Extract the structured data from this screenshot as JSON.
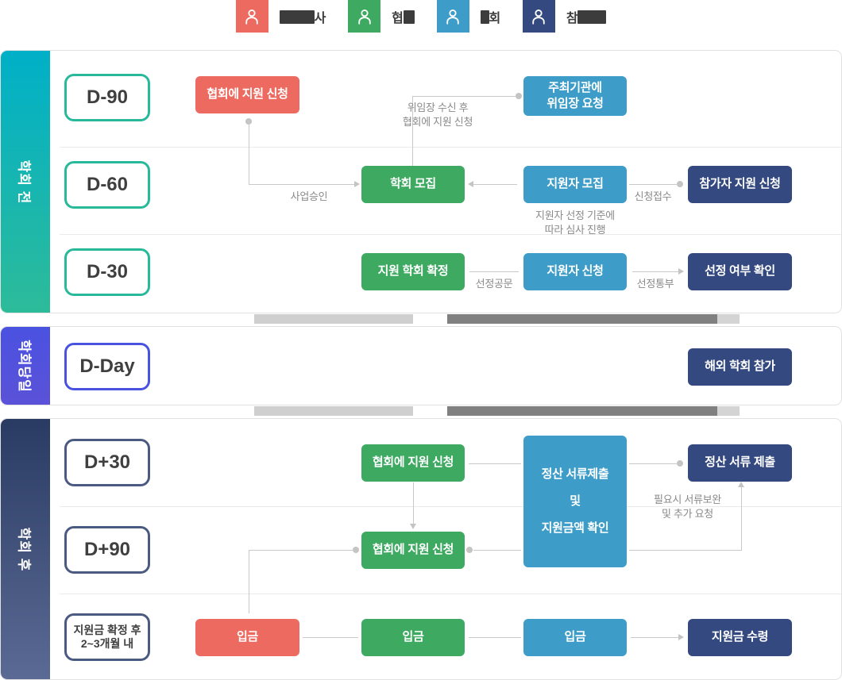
{
  "legend": {
    "items": [
      {
        "label": "주최사",
        "label_visible": "주최사",
        "obscured": true,
        "color": "#ec6a60",
        "icon": "person-icon"
      },
      {
        "label": "협회",
        "label_visible": "협회",
        "obscured": true,
        "color": "#3da961",
        "icon": "person-icon"
      },
      {
        "label": "학회",
        "label_visible": "학회",
        "obscured": true,
        "color": "#3d9dc8",
        "icon": "person-icon"
      },
      {
        "label": "참가자",
        "label_visible": "참가자",
        "obscured": true,
        "color": "#33497f",
        "icon": "person-icon"
      }
    ]
  },
  "sections": [
    {
      "id": "pre",
      "tab_label": "학회 전",
      "tab_color": "#17b5b8"
    },
    {
      "id": "day",
      "tab_label": "학회당일",
      "tab_color": "#4a52e0"
    },
    {
      "id": "post",
      "tab_label": "학회 후",
      "tab_color": "#3b4c76"
    }
  ],
  "pre": {
    "rows": [
      {
        "chip": "D-90",
        "nodes": [
          {
            "label": "협회에 지원 신청",
            "color": "red"
          },
          {
            "label": "주최기관에\n위임장 요청",
            "color": "blue",
            "line1": "주최기관에",
            "line2": "위임장 요청"
          }
        ],
        "edge_labels": [
          {
            "line1": "위임장 수신 후",
            "line2": "협회에 지원 신청"
          }
        ]
      },
      {
        "chip": "D-60",
        "nodes": [
          {
            "label": "학회 모집",
            "color": "green"
          },
          {
            "label": "지원자 모집",
            "color": "blue"
          },
          {
            "label": "참가자 지원 신청",
            "color": "navy"
          }
        ],
        "edge_labels": [
          {
            "line1": "사업승인"
          },
          {
            "line1": "신청접수"
          },
          {
            "line1": "지원자 선정 기준에",
            "line2": "따라 심사 진행"
          }
        ]
      },
      {
        "chip": "D-30",
        "nodes": [
          {
            "label": "지원 학회 확정",
            "color": "green"
          },
          {
            "label": "지원자 신청",
            "color": "blue"
          },
          {
            "label": "선정 여부 확인",
            "color": "navy"
          }
        ],
        "edge_labels": [
          {
            "line1": "선정공문"
          },
          {
            "line1": "선정통부"
          }
        ]
      }
    ]
  },
  "day": {
    "rows": [
      {
        "chip": "D-Day",
        "nodes": [
          {
            "label": "해외 학회 참가",
            "color": "navy"
          }
        ]
      }
    ]
  },
  "post": {
    "rows": [
      {
        "chip": "D+30",
        "nodes": [
          {
            "label": "협회에 지원 신청",
            "color": "green"
          },
          {
            "label": "정산 서류제출\n및\n지원금액 확인",
            "color": "blue",
            "line1": "정산 서류제출",
            "line2": "및",
            "line3": "지원금액 확인"
          },
          {
            "label": "정산 서류 제출",
            "color": "navy"
          }
        ]
      },
      {
        "chip": "D+90",
        "nodes": [
          {
            "label": "협회에 지원 신청",
            "color": "green"
          }
        ],
        "edge_labels": [
          {
            "line1": "필요시 서류보완",
            "line2": "및 추가 요청"
          }
        ]
      },
      {
        "chip": "지원금 확정 후\n2~3개월 내",
        "chip_line1": "지원금 확정 후",
        "chip_line2": "2~3개월 내",
        "nodes": [
          {
            "label": "입금",
            "color": "red"
          },
          {
            "label": "입금",
            "color": "green"
          },
          {
            "label": "입금",
            "color": "blue"
          },
          {
            "label": "지원금 수령",
            "color": "navy"
          }
        ]
      }
    ]
  },
  "colors": {
    "red": "#ec6a60",
    "green": "#3da961",
    "blue": "#3d9dc8",
    "navy": "#33497f",
    "teal_border": "#28b99a",
    "indigo_border": "#4a52e0",
    "navy_border": "#4a5a80",
    "connector": "#c9c9c9"
  }
}
